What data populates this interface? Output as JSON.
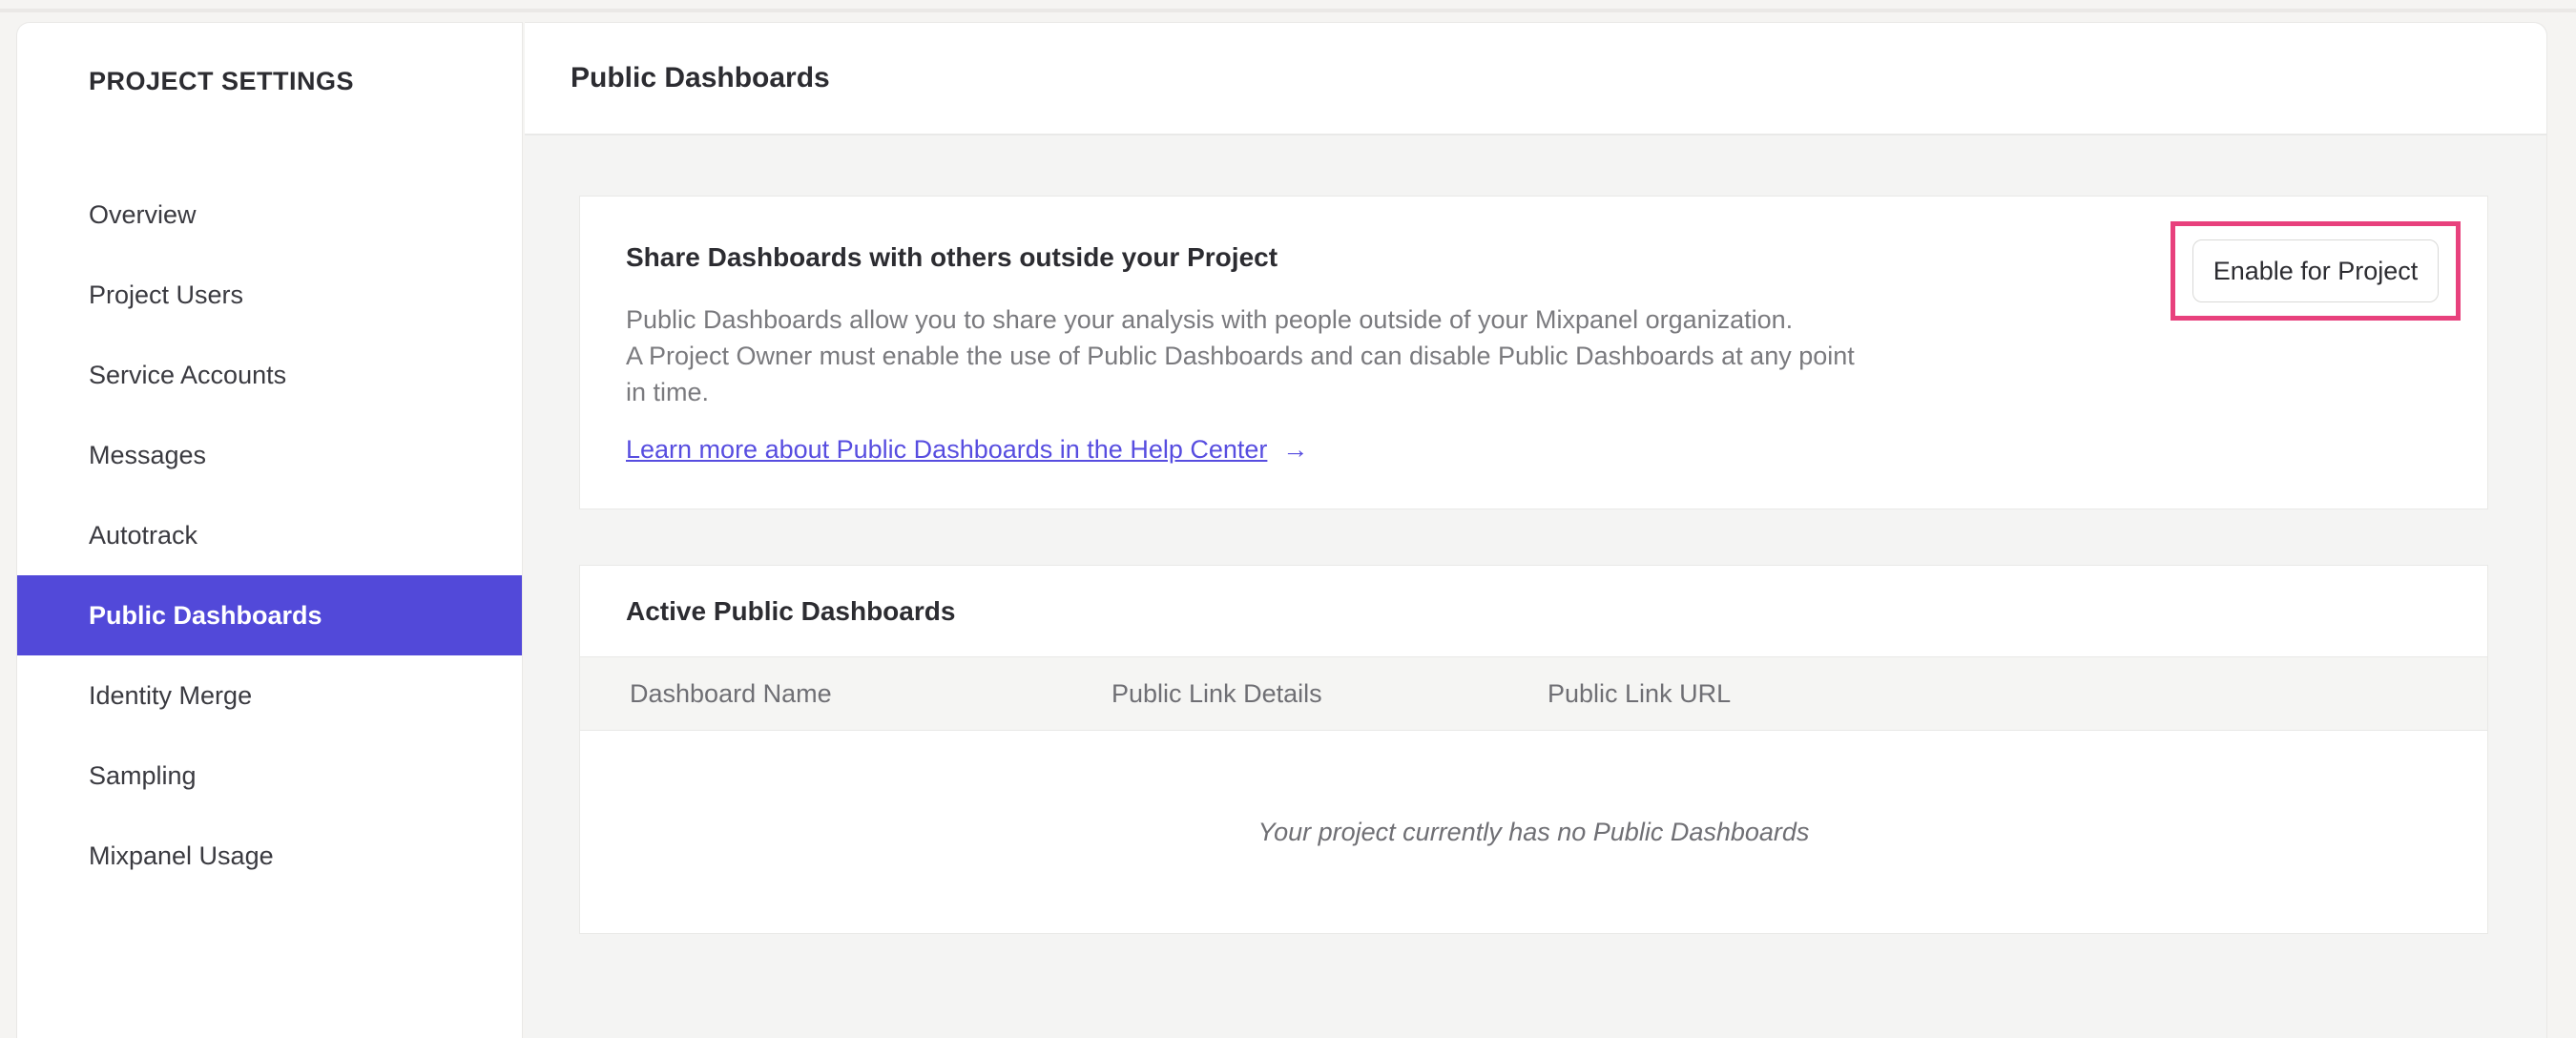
{
  "sidebar": {
    "title": "PROJECT SETTINGS",
    "items": [
      {
        "id": "overview",
        "label": "Overview",
        "selected": false
      },
      {
        "id": "project-users",
        "label": "Project Users",
        "selected": false
      },
      {
        "id": "service-accounts",
        "label": "Service Accounts",
        "selected": false
      },
      {
        "id": "messages",
        "label": "Messages",
        "selected": false
      },
      {
        "id": "autotrack",
        "label": "Autotrack",
        "selected": false
      },
      {
        "id": "public-dashboards",
        "label": "Public Dashboards",
        "selected": true
      },
      {
        "id": "identity-merge",
        "label": "Identity Merge",
        "selected": false
      },
      {
        "id": "sampling",
        "label": "Sampling",
        "selected": false
      },
      {
        "id": "mixpanel-usage",
        "label": "Mixpanel Usage",
        "selected": false
      }
    ]
  },
  "header": {
    "title": "Public Dashboards"
  },
  "share_card": {
    "heading": "Share Dashboards with others outside your Project",
    "body_line1": "Public Dashboards allow you to share your analysis with people outside of your Mixpanel organization.",
    "body_line2": "A Project Owner must enable the use of Public Dashboards and can disable Public Dashboards at any point",
    "body_line3": "in time.",
    "link_label": "Learn more about Public Dashboards in the Help Center",
    "link_arrow": "→",
    "enable_button_label": "Enable for Project"
  },
  "active_card": {
    "heading": "Active Public Dashboards",
    "columns": [
      {
        "label": "Dashboard Name"
      },
      {
        "label": "Public Link Details"
      },
      {
        "label": "Public Link URL"
      }
    ],
    "empty_message": "Your project currently has no Public Dashboards"
  },
  "colors": {
    "accent_purple": "#5249d9",
    "link_purple": "#574de0",
    "highlight_pink": "#e8417d"
  }
}
